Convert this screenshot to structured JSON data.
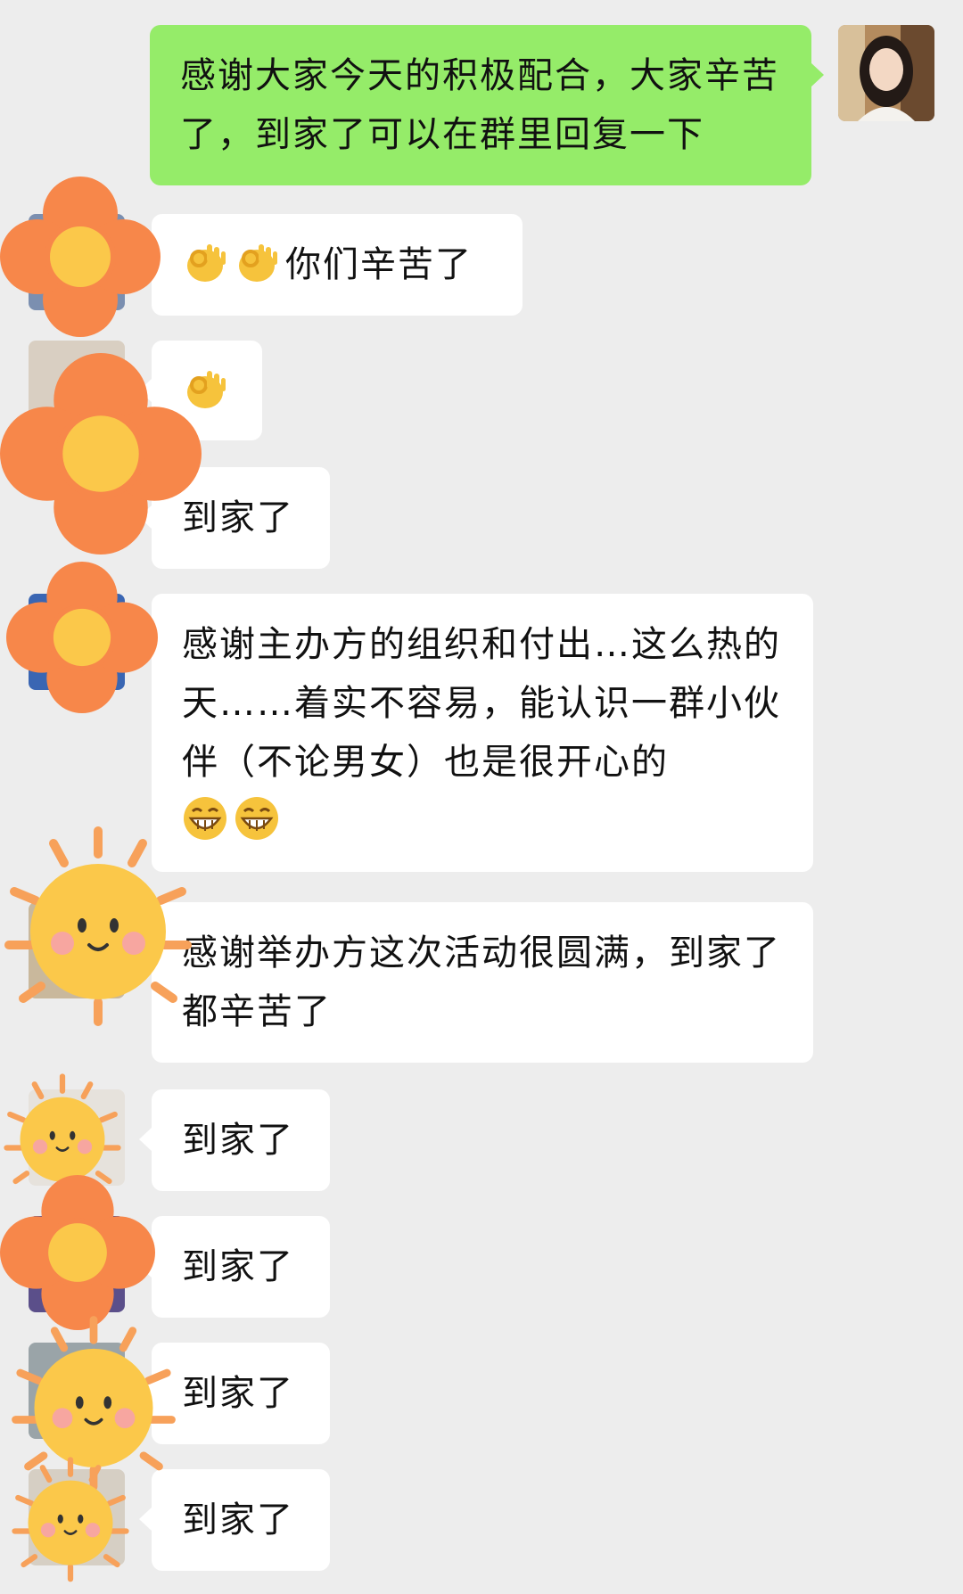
{
  "messages": [
    {
      "sender": "self",
      "text": "感谢大家今天的积极配合，大家辛苦了，到家了可以在群里回复一下"
    },
    {
      "sender": "member",
      "emoji": [
        "ok-hand-icon",
        "ok-hand-icon"
      ],
      "text": "你们辛苦了"
    },
    {
      "sender": "member",
      "emoji": [
        "ok-hand-icon"
      ],
      "text": ""
    },
    {
      "sender": "member",
      "text": "到家了"
    },
    {
      "sender": "member",
      "text": "感谢主办方的组织和付出…这么热的天……着实不容易，能认识一群小伙伴（不论男女）也是很开心的",
      "emoji_after": [
        "grin-icon",
        "grin-icon"
      ]
    },
    {
      "sender": "member",
      "text": "感谢举办方这次活动很圆满，到家了都辛苦了"
    },
    {
      "sender": "member",
      "text": "到家了"
    },
    {
      "sender": "member",
      "text": "到家了"
    },
    {
      "sender": "member",
      "text": "到家了"
    },
    {
      "sender": "member",
      "text": "到家了"
    }
  ],
  "colors": {
    "background": "#ededed",
    "outgoing_bubble": "#95ec69",
    "incoming_bubble": "#ffffff",
    "flower_sticker": "#f7874a",
    "sun_sticker": "#fbc84a"
  },
  "stickers": [
    "flower-sticker",
    "flower-sticker",
    "flower-sticker",
    "sun-sticker",
    "sun-sticker",
    "flower-sticker",
    "sun-sticker",
    "sun-sticker"
  ]
}
